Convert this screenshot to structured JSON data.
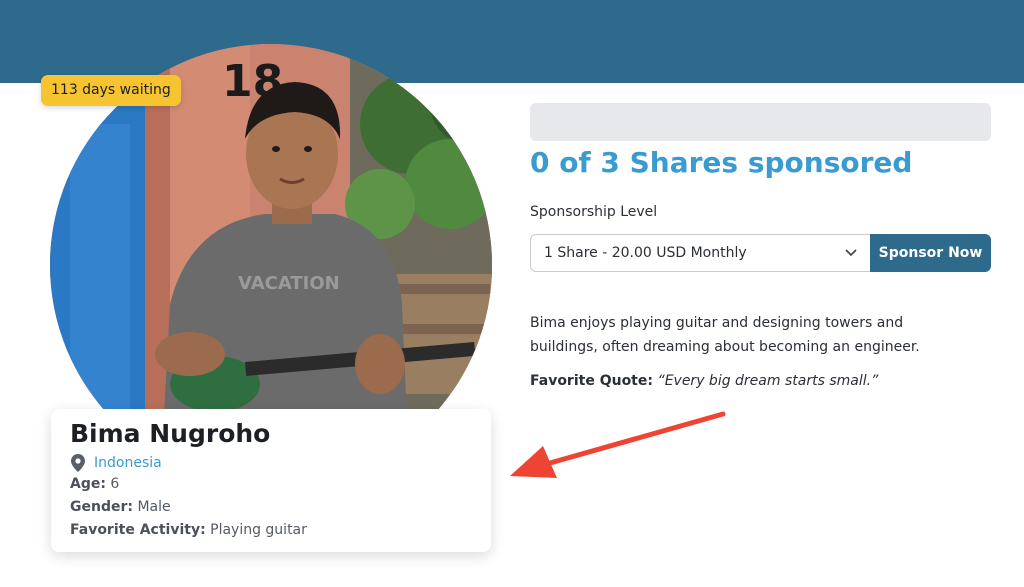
{
  "badge": {
    "waiting": "113 days waiting"
  },
  "child": {
    "name": "Bima Nugroho",
    "location": "Indonesia",
    "age_label": "Age:",
    "age": "6",
    "gender_label": "Gender:",
    "gender": "Male",
    "activity_label": "Favorite Activity:",
    "activity": "Playing guitar"
  },
  "sponsorship": {
    "heading": "0 of 3 Shares sponsored",
    "progress_fraction": 0,
    "level_label": "Sponsorship Level",
    "selected_level": "1 Share - 20.00 USD Monthly",
    "button_label": "Sponsor Now"
  },
  "bio": {
    "text": "Bima enjoys playing guitar and designing towers and buildings, often dreaming about becoming an engineer.",
    "quote_label": "Favorite Quote:",
    "quote": "“Every big dream starts small.”"
  },
  "colors": {
    "banner": "#2e6a8c",
    "accent": "#3a9bd0",
    "badge": "#f6c431",
    "annotation_arrow": "#ee4433"
  },
  "icons": [
    "location-pin-icon",
    "chevron-down-icon"
  ]
}
